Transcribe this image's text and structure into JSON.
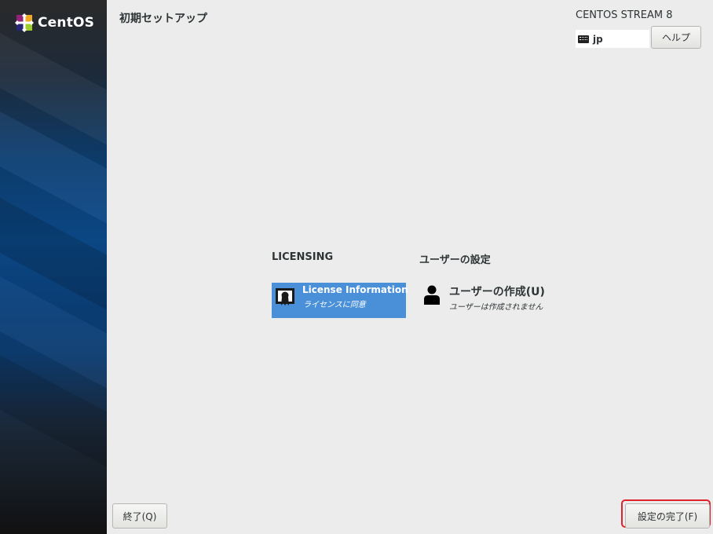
{
  "sidebar": {
    "logo_text": "CentOS",
    "logo_icon": "centos-logo-icon"
  },
  "header": {
    "title": "初期セットアップ",
    "product": "CENTOS STREAM 8",
    "keyboard": {
      "icon": "keyboard-icon",
      "value": "jp"
    },
    "help_label": "ヘルプ"
  },
  "hub": {
    "licensing": {
      "label": "LICENSING",
      "spoke": {
        "icon": "license-icon",
        "title": "License Information",
        "status": "ライセンスに同意"
      }
    },
    "user_settings": {
      "label": "ユーザーの設定",
      "spoke": {
        "icon": "user-icon",
        "title": "ユーザーの作成(U)",
        "status": "ユーザーは作成されません"
      }
    }
  },
  "footer": {
    "quit_label": "終了(Q)",
    "finish_label": "設定の完了(F)"
  },
  "colors": {
    "selected_spoke": "#4a90d9",
    "highlight": "#e0242b",
    "background": "#ececec"
  }
}
